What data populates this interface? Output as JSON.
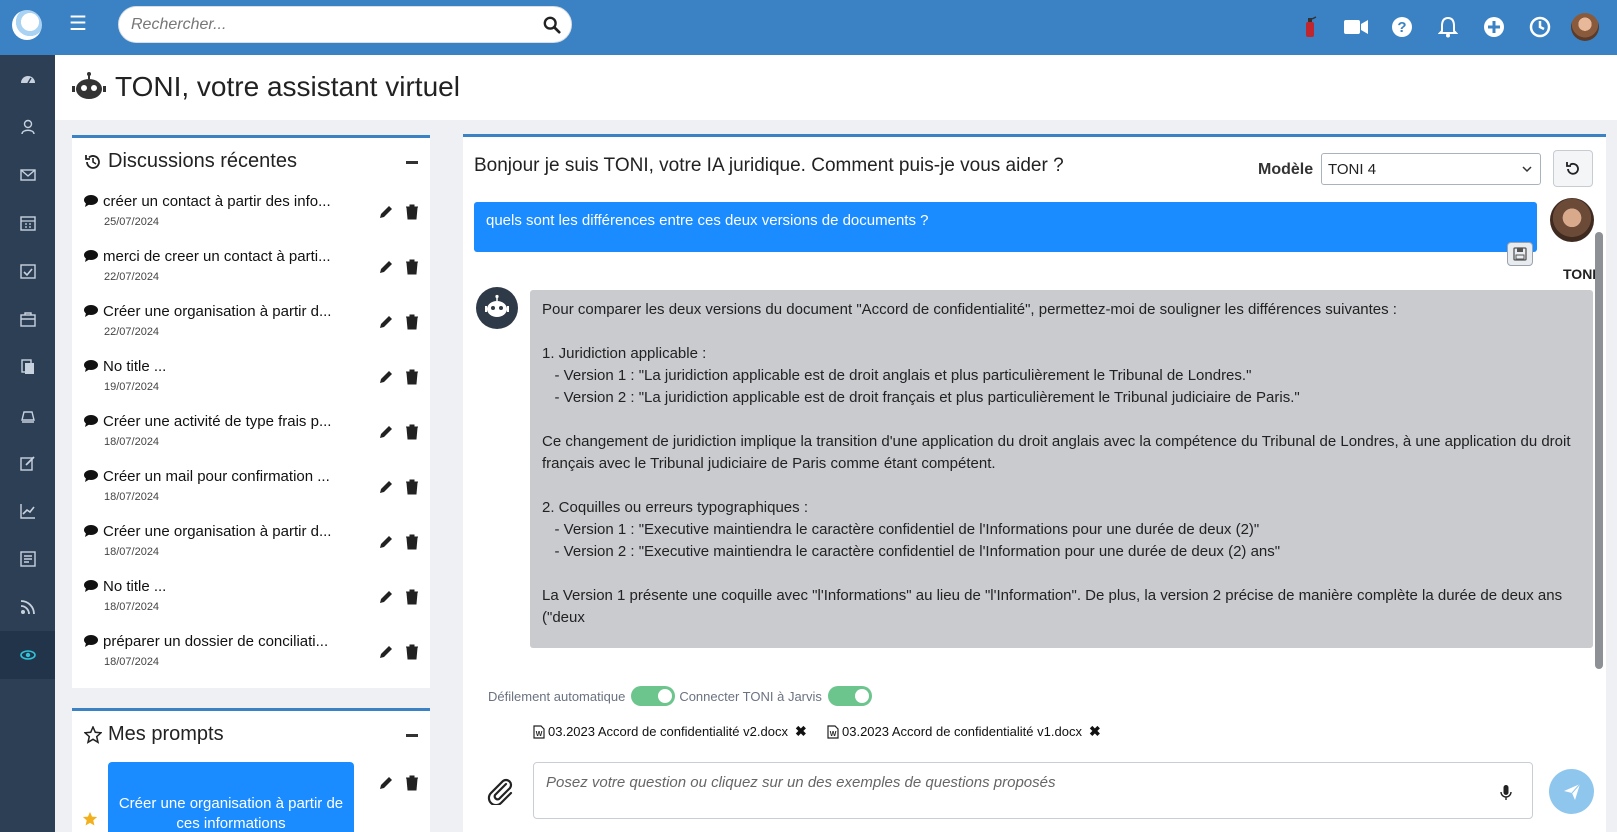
{
  "topbar": {
    "search_placeholder": "Rechercher...",
    "icons": [
      "logo",
      "menu-icon",
      "search-icon",
      "fire-extinguisher-icon",
      "video-icon",
      "help-icon",
      "bell-icon",
      "plus-icon",
      "clock-icon",
      "user-avatar"
    ]
  },
  "sidebar": {
    "items": [
      "dashboard-icon",
      "contacts-icon",
      "mail-icon",
      "calendar-icon",
      "tasks-icon",
      "briefcase-icon",
      "documents-icon",
      "billing-icon",
      "edit-icon",
      "chart-icon",
      "report-icon",
      "rss-icon",
      "toni-icon"
    ],
    "active": "toni-icon"
  },
  "page": {
    "title": "TONI, votre assistant virtuel"
  },
  "discussions": {
    "title": "Discussions récentes",
    "items": [
      {
        "title": "créer un contact à partir des info...",
        "date": "25/07/2024"
      },
      {
        "title": "merci de creer un contact à parti...",
        "date": "22/07/2024"
      },
      {
        "title": "Créer une organisation à partir d...",
        "date": "22/07/2024"
      },
      {
        "title": "No title ...",
        "date": "19/07/2024"
      },
      {
        "title": "Créer une activité de type frais p...",
        "date": "18/07/2024"
      },
      {
        "title": "Créer un mail pour confirmation ...",
        "date": "18/07/2024"
      },
      {
        "title": "Créer une organisation à partir d...",
        "date": "18/07/2024"
      },
      {
        "title": "No title ...",
        "date": "18/07/2024"
      },
      {
        "title": "préparer un dossier de conciliati...",
        "date": "18/07/2024"
      }
    ]
  },
  "prompts": {
    "title": "Mes prompts",
    "items": [
      {
        "label": "Créer une organisation à partir de ces informations"
      }
    ]
  },
  "chat": {
    "greeting": "Bonjour je suis TONI, votre IA juridique. Comment puis-je vous aider ?",
    "model_label": "Modèle",
    "model_value": "TONI 4",
    "user_message": "quels sont les différences entre ces deux versions de documents ?",
    "assistant_name": "TONI",
    "bot_message": "Pour comparer les deux versions du document \"Accord de confidentialité\", permettez-moi de souligner les différences suivantes :\n\n1. Juridiction applicable :\n   - Version 1 : \"La juridiction applicable est de droit anglais et plus particulièrement le Tribunal de Londres.\"\n   - Version 2 : \"La juridiction applicable est de droit français et plus particulièrement le Tribunal judiciaire de Paris.\"\n\nCe changement de juridiction implique la transition d'une application du droit anglais avec la compétence du Tribunal de Londres, à une application du droit français avec le Tribunal judiciaire de Paris comme étant compétent.\n\n2. Coquilles ou erreurs typographiques :\n   - Version 1 : \"Executive maintiendra le caractère confidentiel de l'Informations pour une durée de deux (2)\"\n   - Version 2 : \"Executive maintiendra le caractère confidentiel de l'Information pour une durée de deux (2) ans\"\n\nLa Version 1 présente une coquille avec \"l'Informations\" au lieu de \"l'Information\". De plus, la version 2 précise de manière complète la durée de deux ans (\"deux",
    "auto_scroll_label": "Défilement automatique",
    "auto_scroll_on": true,
    "connect_label": "Connecter TONI à Jarvis",
    "connect_on": true,
    "attachments": [
      "03.2023 Accord de confidentialité v2.docx",
      "03.2023 Accord de confidentialité v1.docx"
    ],
    "input_placeholder": "Posez votre question ou cliquez sur un des exemples de questions proposés"
  },
  "colors": {
    "topbar": "#3a82c4",
    "sidebar": "#2d3f55",
    "accent_blue": "#1a8cff",
    "toggle_green": "#6cc58d",
    "bot_bubble": "#c9cbcf"
  }
}
